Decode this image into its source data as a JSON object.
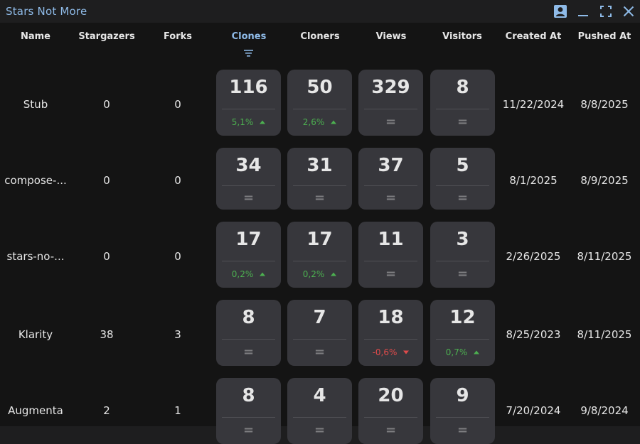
{
  "window": {
    "title": "Stars Not More",
    "buttons": [
      "account-icon",
      "minimize-icon",
      "maximize-icon",
      "close-icon"
    ]
  },
  "table": {
    "columns": [
      "Name",
      "Stargazers",
      "Forks",
      "Clones",
      "Cloners",
      "Views",
      "Visitors",
      "Created At",
      "Pushed At"
    ],
    "sorted_column": "Clones",
    "rows": [
      {
        "name": "Stub",
        "stargazers": "0",
        "forks": "0",
        "created_at": "11/22/2024",
        "pushed_at": "8/8/2025",
        "metrics": [
          {
            "value": "116",
            "change": "5,1%",
            "trend": "up"
          },
          {
            "value": "50",
            "change": "2,6%",
            "trend": "up"
          },
          {
            "value": "329",
            "change": "=",
            "trend": "equal"
          },
          {
            "value": "8",
            "change": "=",
            "trend": "equal"
          }
        ]
      },
      {
        "name": "compose-...",
        "stargazers": "0",
        "forks": "0",
        "created_at": "8/1/2025",
        "pushed_at": "8/9/2025",
        "metrics": [
          {
            "value": "34",
            "change": "=",
            "trend": "equal"
          },
          {
            "value": "31",
            "change": "=",
            "trend": "equal"
          },
          {
            "value": "37",
            "change": "=",
            "trend": "equal"
          },
          {
            "value": "5",
            "change": "=",
            "trend": "equal"
          }
        ]
      },
      {
        "name": "stars-no-...",
        "stargazers": "0",
        "forks": "0",
        "created_at": "2/26/2025",
        "pushed_at": "8/11/2025",
        "metrics": [
          {
            "value": "17",
            "change": "0,2%",
            "trend": "up"
          },
          {
            "value": "17",
            "change": "0,2%",
            "trend": "up"
          },
          {
            "value": "11",
            "change": "=",
            "trend": "equal"
          },
          {
            "value": "3",
            "change": "=",
            "trend": "equal"
          }
        ]
      },
      {
        "name": "Klarity",
        "stargazers": "38",
        "forks": "3",
        "created_at": "8/25/2023",
        "pushed_at": "8/11/2025",
        "metrics": [
          {
            "value": "8",
            "change": "=",
            "trend": "equal"
          },
          {
            "value": "7",
            "change": "=",
            "trend": "equal"
          },
          {
            "value": "18",
            "change": "-0,6%",
            "trend": "down"
          },
          {
            "value": "12",
            "change": "0,7%",
            "trend": "up"
          }
        ]
      },
      {
        "name": "Augmenta",
        "stargazers": "2",
        "forks": "1",
        "created_at": "7/20/2024",
        "pushed_at": "9/8/2024",
        "metrics": [
          {
            "value": "8",
            "change": "=",
            "trend": "equal"
          },
          {
            "value": "4",
            "change": "=",
            "trend": "equal"
          },
          {
            "value": "20",
            "change": "=",
            "trend": "equal"
          },
          {
            "value": "9",
            "change": "=",
            "trend": "equal"
          }
        ]
      }
    ]
  },
  "colors": {
    "accent": "#8fbbe8",
    "background": "#141414",
    "card": "#37373c",
    "trend_up": "#4caf50",
    "trend_down": "#e04b4b"
  }
}
